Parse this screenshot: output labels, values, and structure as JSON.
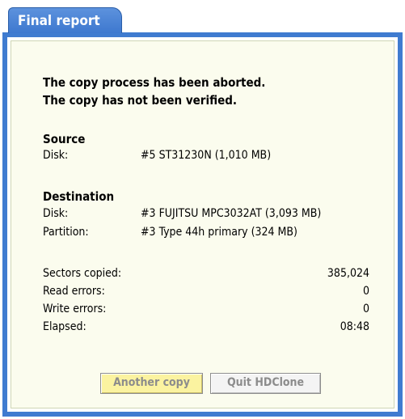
{
  "tab": {
    "title": "Final report"
  },
  "message": {
    "line1": "The copy process has been aborted.",
    "line2": "The copy has not been verified."
  },
  "source": {
    "heading": "Source",
    "disk_label": "Disk:",
    "disk_value": "#5 ST31230N (1,010 MB)"
  },
  "destination": {
    "heading": "Destination",
    "disk_label": "Disk:",
    "disk_value": "#3 FUJITSU MPC3032AT (3,093 MB)",
    "partition_label": "Partition:",
    "partition_value": "#3 Type 44h primary (324 MB)"
  },
  "stats": {
    "sectors_label": "Sectors copied:",
    "sectors_value": "385,024",
    "read_errors_label": "Read errors:",
    "read_errors_value": "0",
    "write_errors_label": "Write errors:",
    "write_errors_value": "0",
    "elapsed_label": "Elapsed:",
    "elapsed_value": "08:48"
  },
  "buttons": {
    "another_copy": "Another copy",
    "quit": "Quit HDClone"
  },
  "colors": {
    "frame": "#3f7bd0",
    "panel_background": "#fbfcee",
    "primary_button": "#fbf3a0"
  }
}
